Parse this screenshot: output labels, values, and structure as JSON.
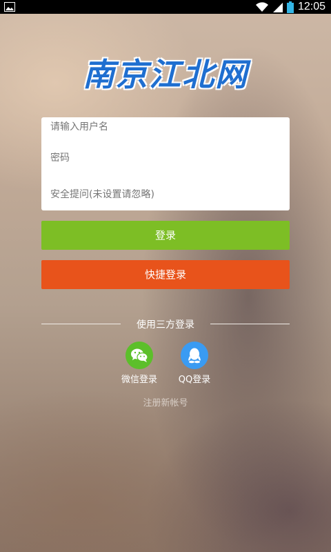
{
  "status_bar": {
    "time": "12:05",
    "icons": [
      "image-icon",
      "wifi-icon",
      "signal-icon",
      "battery-icon"
    ]
  },
  "logo": {
    "text": "南京江北网"
  },
  "form": {
    "username_placeholder": "请输入用户名",
    "password_placeholder": "密码",
    "security_question_placeholder": "安全提问(未设置请忽略)"
  },
  "buttons": {
    "login": "登录",
    "quick_login": "快捷登录"
  },
  "third_party": {
    "divider_text": "使用三方登录",
    "wechat_label": "微信登录",
    "qq_label": "QQ登录"
  },
  "register": {
    "text": "注册新帐号"
  },
  "colors": {
    "login_button": "#7dbe25",
    "quick_login_button": "#e8531b",
    "wechat": "#5cbf2a",
    "qq": "#3a9bf2",
    "logo": "#1f6fd0"
  }
}
